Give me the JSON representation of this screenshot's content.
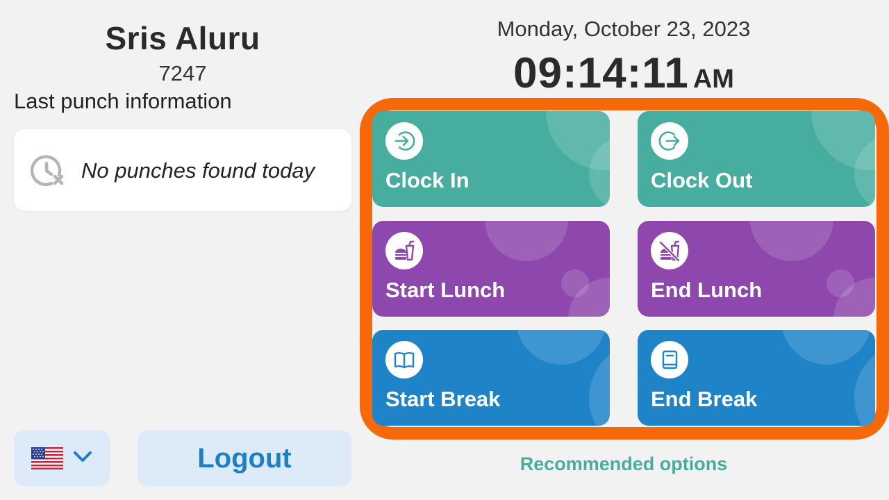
{
  "employee": {
    "name": "Sris Aluru",
    "id": "7247"
  },
  "last_punch": {
    "heading": "Last punch information",
    "empty_text": "No punches found today"
  },
  "datetime": {
    "date": "Monday, October 23, 2023",
    "time": "09:14:11",
    "ampm": "AM"
  },
  "actions": {
    "clock_in": "Clock In",
    "clock_out": "Clock Out",
    "start_lunch": "Start Lunch",
    "end_lunch": "End Lunch",
    "start_break": "Start Break",
    "end_break": "End Break",
    "recommended_label": "Recommended options"
  },
  "footer": {
    "language_icon": "us-flag-icon",
    "logout_label": "Logout"
  },
  "colors": {
    "green": "#47ad9f",
    "purple": "#8e47ad",
    "blue": "#1f84c7",
    "highlight": "#f5690a",
    "logout_text": "#1f7fc4",
    "button_bg": "#dcebf7"
  }
}
